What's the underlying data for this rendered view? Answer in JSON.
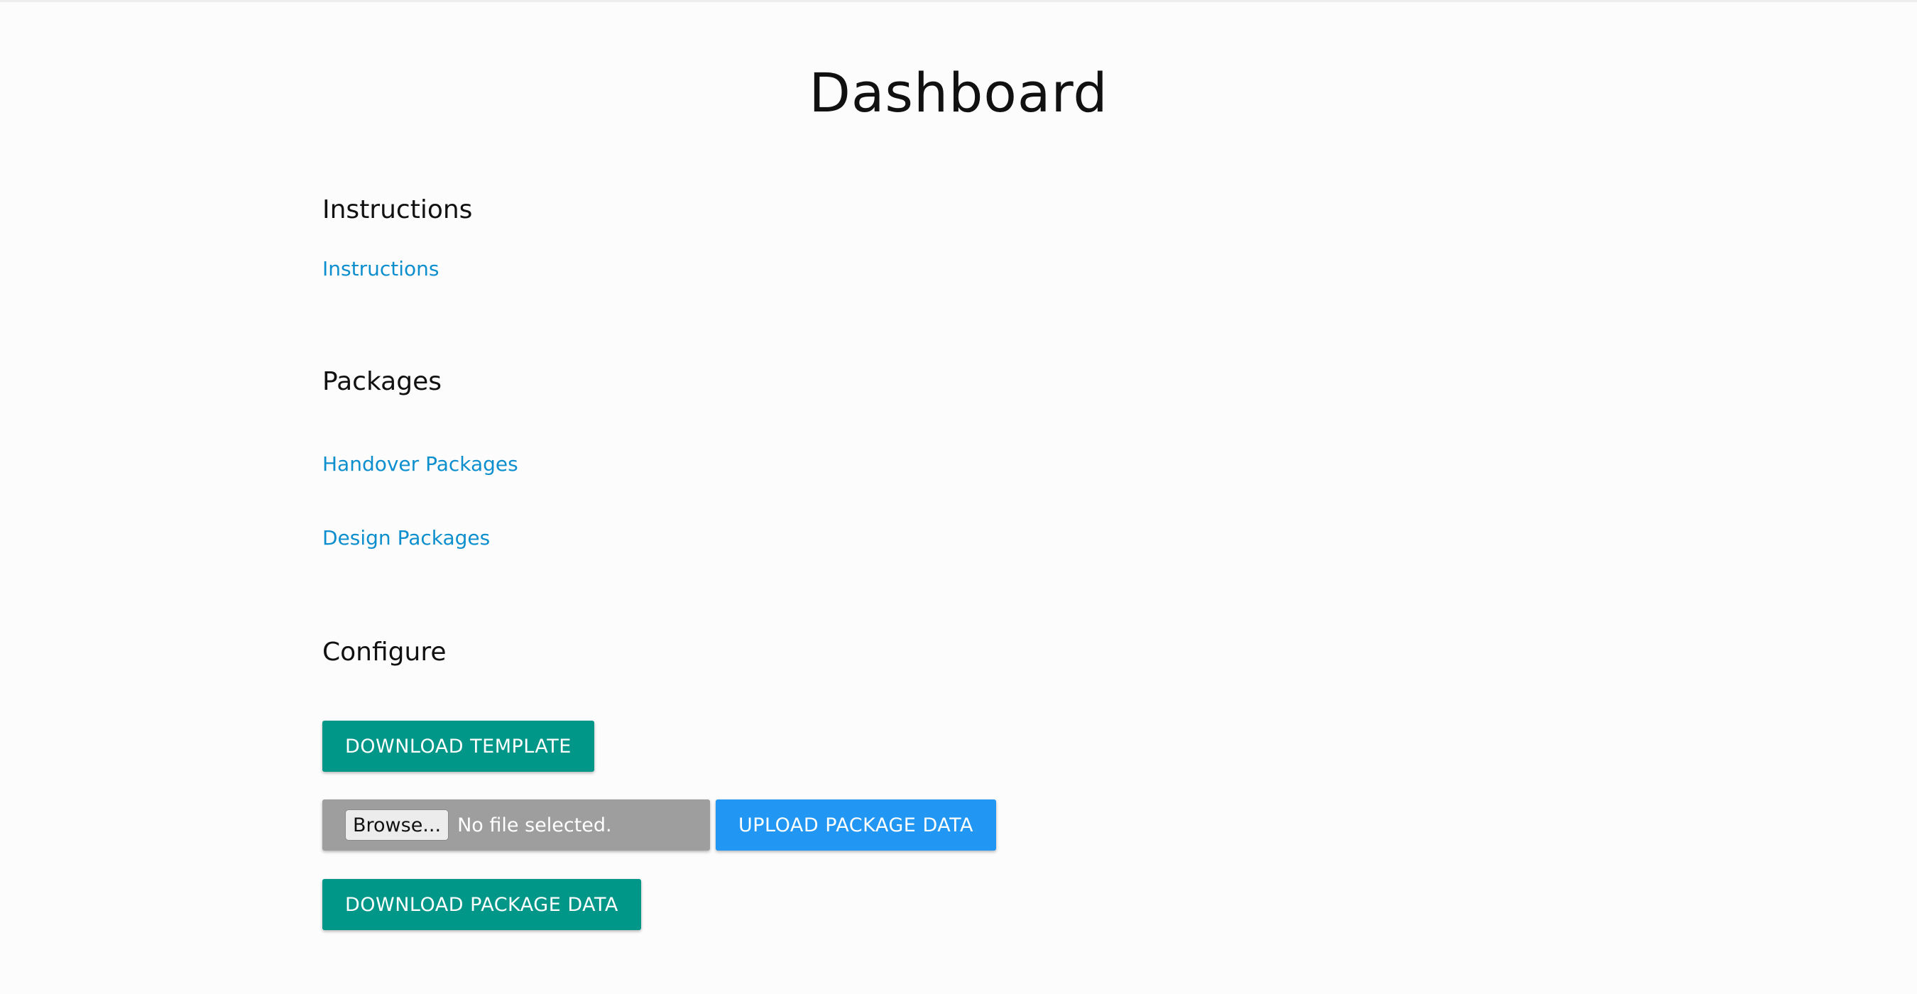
{
  "page": {
    "title": "Dashboard"
  },
  "instructions": {
    "heading": "Instructions",
    "link_label": "Instructions"
  },
  "packages": {
    "heading": "Packages",
    "links": [
      "Handover Packages",
      "Design Packages"
    ]
  },
  "configure": {
    "heading": "Configure",
    "download_template_label": "DOWNLOAD TEMPLATE",
    "browse_label": "Browse...",
    "file_status": "No file selected.",
    "upload_label": "UPLOAD PACKAGE DATA",
    "download_package_data_label": "DOWNLOAD PACKAGE DATA"
  },
  "colors": {
    "link": "#0d8fce",
    "teal_button": "#009688",
    "blue_button": "#2196f3",
    "file_input_bg": "#9e9e9e"
  }
}
